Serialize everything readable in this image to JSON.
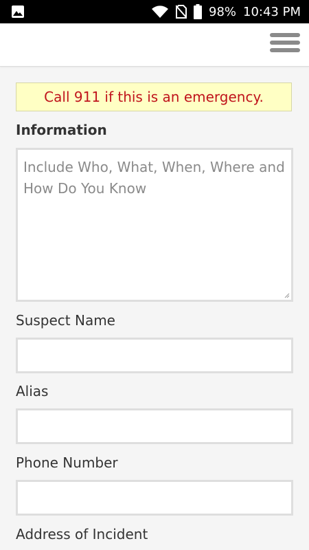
{
  "status_bar": {
    "battery": "98%",
    "time": "10:43 PM",
    "icons": [
      "image-icon",
      "wifi-icon",
      "no-sim-icon",
      "battery-icon"
    ]
  },
  "app_bar": {
    "menu_icon": "hamburger-menu-icon"
  },
  "form": {
    "alert": "Call 911 if this is an emergency.",
    "information_label": "Information",
    "information_placeholder": "Include Who, What, When, Where and How Do You Know",
    "suspect_name_label": "Suspect Name",
    "suspect_name_value": "",
    "alias_label": "Alias",
    "alias_value": "",
    "phone_label": "Phone Number",
    "phone_value": "",
    "address_label": "Address of Incident"
  },
  "colors": {
    "alert_text": "#c0141c",
    "alert_bg": "#ffffc4",
    "placeholder": "#8a8a8a"
  }
}
